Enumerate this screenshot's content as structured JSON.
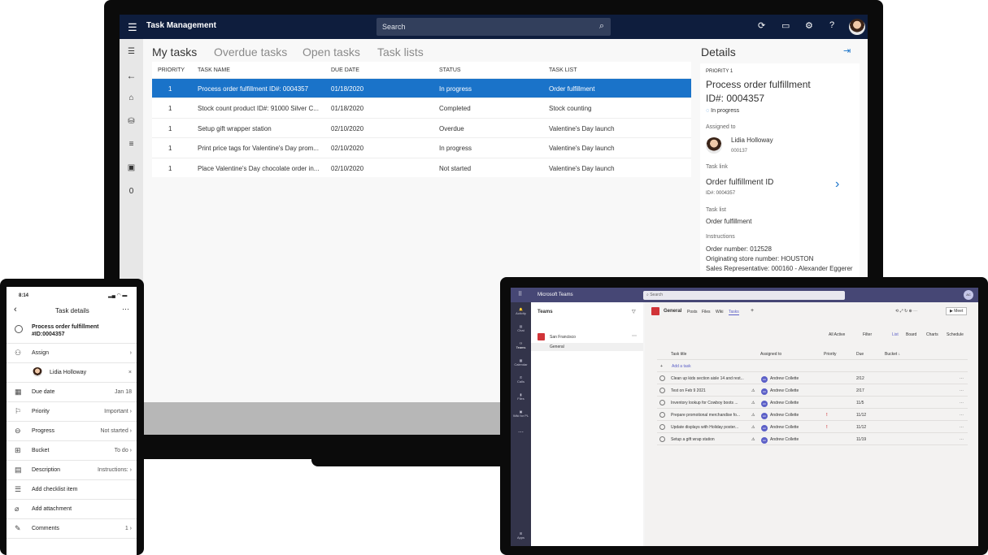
{
  "laptop": {
    "app_title": "Task Management",
    "search_placeholder": "Search",
    "tabs": [
      "My tasks",
      "Overdue tasks",
      "Open tasks",
      "Task lists"
    ],
    "columns": [
      "PRIORITY",
      "TASK NAME",
      "DUE DATE",
      "STATUS",
      "TASK LIST"
    ],
    "rows": [
      {
        "priority": "1",
        "name": "Process order fulfillment ID#: 0004357",
        "due": "01/18/2020",
        "status": "In progress",
        "list": "Order fulfillment"
      },
      {
        "priority": "1",
        "name": "Stock count product ID#: 91000  Silver C...",
        "due": "01/18/2020",
        "status": "Completed",
        "list": "Stock counting"
      },
      {
        "priority": "1",
        "name": "Setup gift wrapper station",
        "due": "02/10/2020",
        "status": "Overdue",
        "list": "Valentine's Day launch"
      },
      {
        "priority": "1",
        "name": "Print price tags for Valentine's Day prom...",
        "due": "02/10/2020",
        "status": "In progress",
        "list": "Valentine's Day launch"
      },
      {
        "priority": "1",
        "name": "Place Valentine's Day chocolate order in...",
        "due": "02/10/2020",
        "status": "Not started",
        "list": "Valentine's Day launch"
      }
    ],
    "rail_count": "0",
    "details": {
      "heading": "Details",
      "priority": "PRIORITY 1",
      "title_line1": "Process order fulfillment",
      "title_line2": "ID#: 0004357",
      "status": "In progress",
      "assigned_label": "Assigned to",
      "assignee": "Lidia Holloway",
      "assignee_id": "000137",
      "task_link_label": "Task link",
      "task_link_title": "Order fulfillment ID",
      "task_link_sub": "ID#: 0004357",
      "task_list_label": "Task list",
      "task_list": "Order fulfillment",
      "instructions_label": "Instructions",
      "instr1": "Order number: 012528",
      "instr2": "Originating store number: HOUSTON",
      "instr3": "Sales Representative: 000160 - Alexander Eggerer"
    }
  },
  "phone": {
    "time": "8:14",
    "header": "Task details",
    "task_title_1": "Process order fulfillment",
    "task_title_2": "#ID:0004357",
    "assign_label": "Assign",
    "assignee": "Lidia Holloway",
    "due_label": "Due date",
    "due_value": "Jan 18",
    "priority_label": "Priority",
    "priority_value": "Important",
    "progress_label": "Progress",
    "progress_value": "Not started",
    "bucket_label": "Bucket",
    "bucket_value": "To do",
    "description_label": "Description",
    "description_value": "Instructions:",
    "checklist_label": "Add checklist item",
    "attachment_label": "Add attachment",
    "comments_label": "Comments",
    "comments_count": "1"
  },
  "teams": {
    "app_title": "Microsoft Teams",
    "search_placeholder": "Search",
    "user_initials": "AC",
    "rail": [
      "Activity",
      "Chat",
      "Teams",
      "Calendar",
      "Calls",
      "Files",
      "Wiki for PL",
      "Apps"
    ],
    "list_header": "Teams",
    "team_name": "San Francisco",
    "channel": "General",
    "channel_title": "General",
    "channel_tabs": [
      "Posts",
      "Files",
      "Wiki",
      "Tasks"
    ],
    "meet_label": "Meet",
    "filters": {
      "all_active": "All Active",
      "filter": "Filter",
      "list": "List",
      "board": "Board",
      "charts": "Charts",
      "schedule": "Schedule"
    },
    "columns": [
      "Task title",
      "Assigned to",
      "Priority",
      "Due",
      "Bucket ↓"
    ],
    "add_task": "Add a task",
    "rows": [
      {
        "title": "Clean up kids section aisle 14 and rest...",
        "assignee": "Andrew Collette",
        "priority": "",
        "due": "2/12"
      },
      {
        "title": "Test on Feb 9 2021",
        "assignee": "Andrew Collette",
        "priority": "",
        "due": "2/17"
      },
      {
        "title": "Inventory lookup for Cowboy boots ...",
        "assignee": "Andrew Collette",
        "priority": "",
        "due": "11/5"
      },
      {
        "title": "Prepare promotional merchandise fo...",
        "assignee": "Andrew Collette",
        "priority": "!",
        "due": "11/12"
      },
      {
        "title": "Update displays with Holiday poster...",
        "assignee": "Andrew Collette",
        "priority": "!",
        "due": "11/12"
      },
      {
        "title": "Setup a gift wrap station",
        "assignee": "Andrew Collette",
        "priority": "",
        "due": "11/19"
      }
    ]
  },
  "colors": {
    "navy": "#0e1d3d",
    "selected": "#1a73c9",
    "teams_purple": "#464775",
    "urgent": "#d13438"
  }
}
